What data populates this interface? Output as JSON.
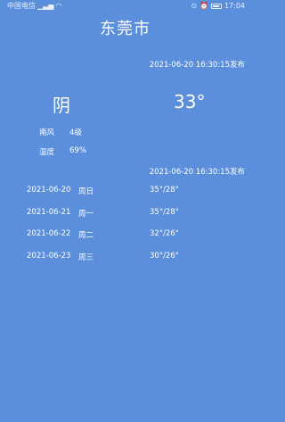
{
  "status_bar": {
    "carrier": "中国电信",
    "time": "17:04"
  },
  "city": "东莞市",
  "publish_time_1": "2021-06-20 16:30:15发布",
  "current": {
    "weather": "阴",
    "temperature": "33°",
    "wind_label": "南风",
    "wind_value": "4级",
    "humidity_label": "湿度",
    "humidity_value": "69%"
  },
  "publish_time_2": "2021-06-20 16:30:15发布",
  "forecast": [
    {
      "date": "2021-06-20",
      "weekday": "周日",
      "temps": "35°/28°"
    },
    {
      "date": "2021-06-21",
      "weekday": "周一",
      "temps": "35°/28°"
    },
    {
      "date": "2021-06-22",
      "weekday": "周二",
      "temps": "32°/26°"
    },
    {
      "date": "2021-06-23",
      "weekday": "周三",
      "temps": "30°/26°"
    }
  ]
}
